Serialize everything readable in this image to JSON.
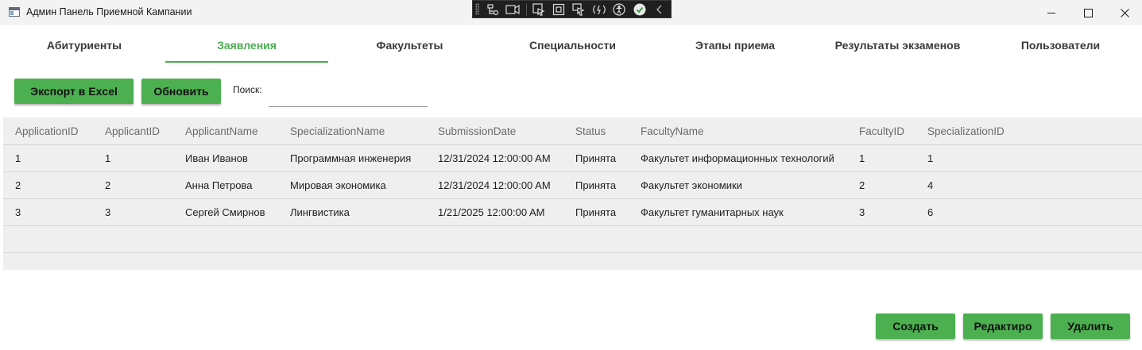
{
  "window": {
    "title": "Админ Панель Приемной Кампании"
  },
  "tabs": [
    {
      "label": "Абитуриенты",
      "active": false
    },
    {
      "label": "Заявления",
      "active": true
    },
    {
      "label": "Факультеты",
      "active": false
    },
    {
      "label": "Специальности",
      "active": false
    },
    {
      "label": "Этапы приема",
      "active": false
    },
    {
      "label": "Результаты экзаменов",
      "active": false
    },
    {
      "label": "Пользователи",
      "active": false
    }
  ],
  "toolbar": {
    "export_label": "Экспорт в Excel",
    "refresh_label": "Обновить",
    "search_label": "Поиск:",
    "search_value": ""
  },
  "grid": {
    "columns": [
      "ApplicationID",
      "ApplicantID",
      "ApplicantName",
      "SpecializationName",
      "SubmissionDate",
      "Status",
      "FacultyName",
      "FacultyID",
      "SpecializationID"
    ],
    "rows": [
      [
        "1",
        "1",
        "Иван Иванов",
        "Программная инженерия",
        "12/31/2024 12:00:00 AM",
        "Принята",
        "Факультет информационных технологий",
        "1",
        "1"
      ],
      [
        "2",
        "2",
        "Анна Петрова",
        "Мировая экономика",
        "12/31/2024 12:00:00 AM",
        "Принята",
        "Факультет экономики",
        "2",
        "4"
      ],
      [
        "3",
        "3",
        "Сергей Смирнов",
        "Лингвистика",
        "1/21/2025 12:00:00 AM",
        "Принята",
        "Факультет гуманитарных наук",
        "3",
        "6"
      ],
      [
        "",
        "",
        "",
        "",
        "",
        "",
        "",
        "",
        ""
      ]
    ]
  },
  "actions": {
    "create_label": "Создать",
    "edit_label": "Редактиро",
    "delete_label": "Удалить"
  },
  "colors": {
    "accent": "#4caf50",
    "grid_background": "#efefef",
    "titlebar": "#f3f3f3"
  }
}
